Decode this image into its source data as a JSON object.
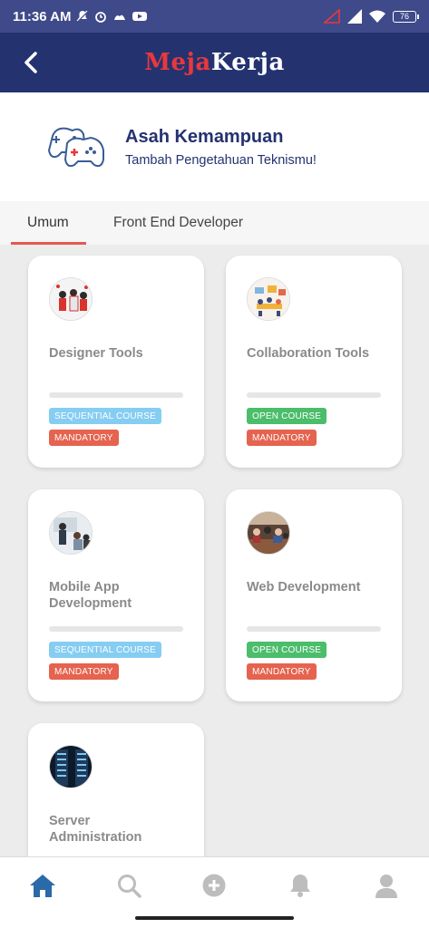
{
  "status_bar": {
    "time": "11:36 AM",
    "battery": "76"
  },
  "app": {
    "logo_part1": "Meja",
    "logo_part2": "Kerja"
  },
  "hero": {
    "title": "Asah Kemampuan",
    "subtitle": "Tambah Pengetahuan Teknismu!"
  },
  "tabs": [
    {
      "label": "Umum",
      "active": true
    },
    {
      "label": "Front End Developer",
      "active": false
    }
  ],
  "courses": [
    {
      "title": "Designer Tools",
      "type": "SEQUENTIAL COURSE",
      "requirement": "MANDATORY",
      "progress": 0
    },
    {
      "title": "Collaboration Tools",
      "type": "OPEN COURSE",
      "requirement": "MANDATORY",
      "progress": 0
    },
    {
      "title": "Mobile App Development",
      "type": "SEQUENTIAL COURSE",
      "requirement": "MANDATORY",
      "progress": 0
    },
    {
      "title": "Web Development",
      "type": "OPEN COURSE",
      "requirement": "MANDATORY",
      "progress": 0
    },
    {
      "title": "Server Administration",
      "type": "",
      "requirement": "",
      "progress": 0
    }
  ],
  "bottom_nav": [
    {
      "icon": "home-icon",
      "active": true
    },
    {
      "icon": "search-icon",
      "active": false
    },
    {
      "icon": "add-circle-icon",
      "active": false
    },
    {
      "icon": "bell-icon",
      "active": false
    },
    {
      "icon": "profile-icon",
      "active": false
    }
  ],
  "colors": {
    "primary": "#243270",
    "accent": "#e8383d",
    "active_nav": "#2a6aa8",
    "inactive_nav": "#bdbdbd"
  }
}
